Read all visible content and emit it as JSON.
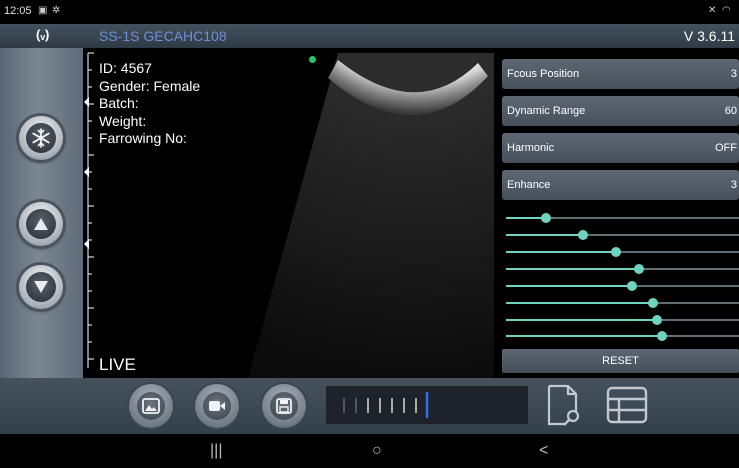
{
  "status_bar": {
    "time": "12:05",
    "left_icons": [
      "gallery-icon",
      "settings-notification-icon"
    ],
    "right_icons": [
      "mute-icon",
      "wifi-icon"
    ]
  },
  "title_bar": {
    "device": "SS-1S GECAHC108",
    "version": "V 3.6.11",
    "antenna_icon": "wireless-signal-icon"
  },
  "patient": {
    "id": "ID: 4567",
    "gender": "Gender: Female",
    "batch": "Batch:",
    "weight": "Weight:",
    "farrowing": "Farrowing No:"
  },
  "image": {
    "mode": "LIVE",
    "status_dot_color": "#27c26a"
  },
  "left_controls": {
    "freeze": "snowflake-icon",
    "up": "up-arrow-icon",
    "down": "down-arrow-icon"
  },
  "params": [
    {
      "label": "Fcous Position",
      "value": "3"
    },
    {
      "label": "Dynamic Range",
      "value": "60"
    },
    {
      "label": "Harmonic",
      "value": "OFF"
    },
    {
      "label": "Enhance",
      "value": "3"
    }
  ],
  "sliders": [
    0.17,
    0.33,
    0.47,
    0.57,
    0.54,
    0.63,
    0.65,
    0.67
  ],
  "reset_label": "RESET",
  "toolbar": {
    "icons": [
      "image-icon",
      "video-icon",
      "save-icon",
      "file-search-icon",
      "table-icon"
    ],
    "cine_frames_filled": 6
  },
  "nav_bar": {
    "recents": "|||",
    "home": "○",
    "back": "<"
  },
  "colors": {
    "accent": "#6fd3c1",
    "title_text": "#6f8fd8",
    "panel": "#505b66"
  }
}
